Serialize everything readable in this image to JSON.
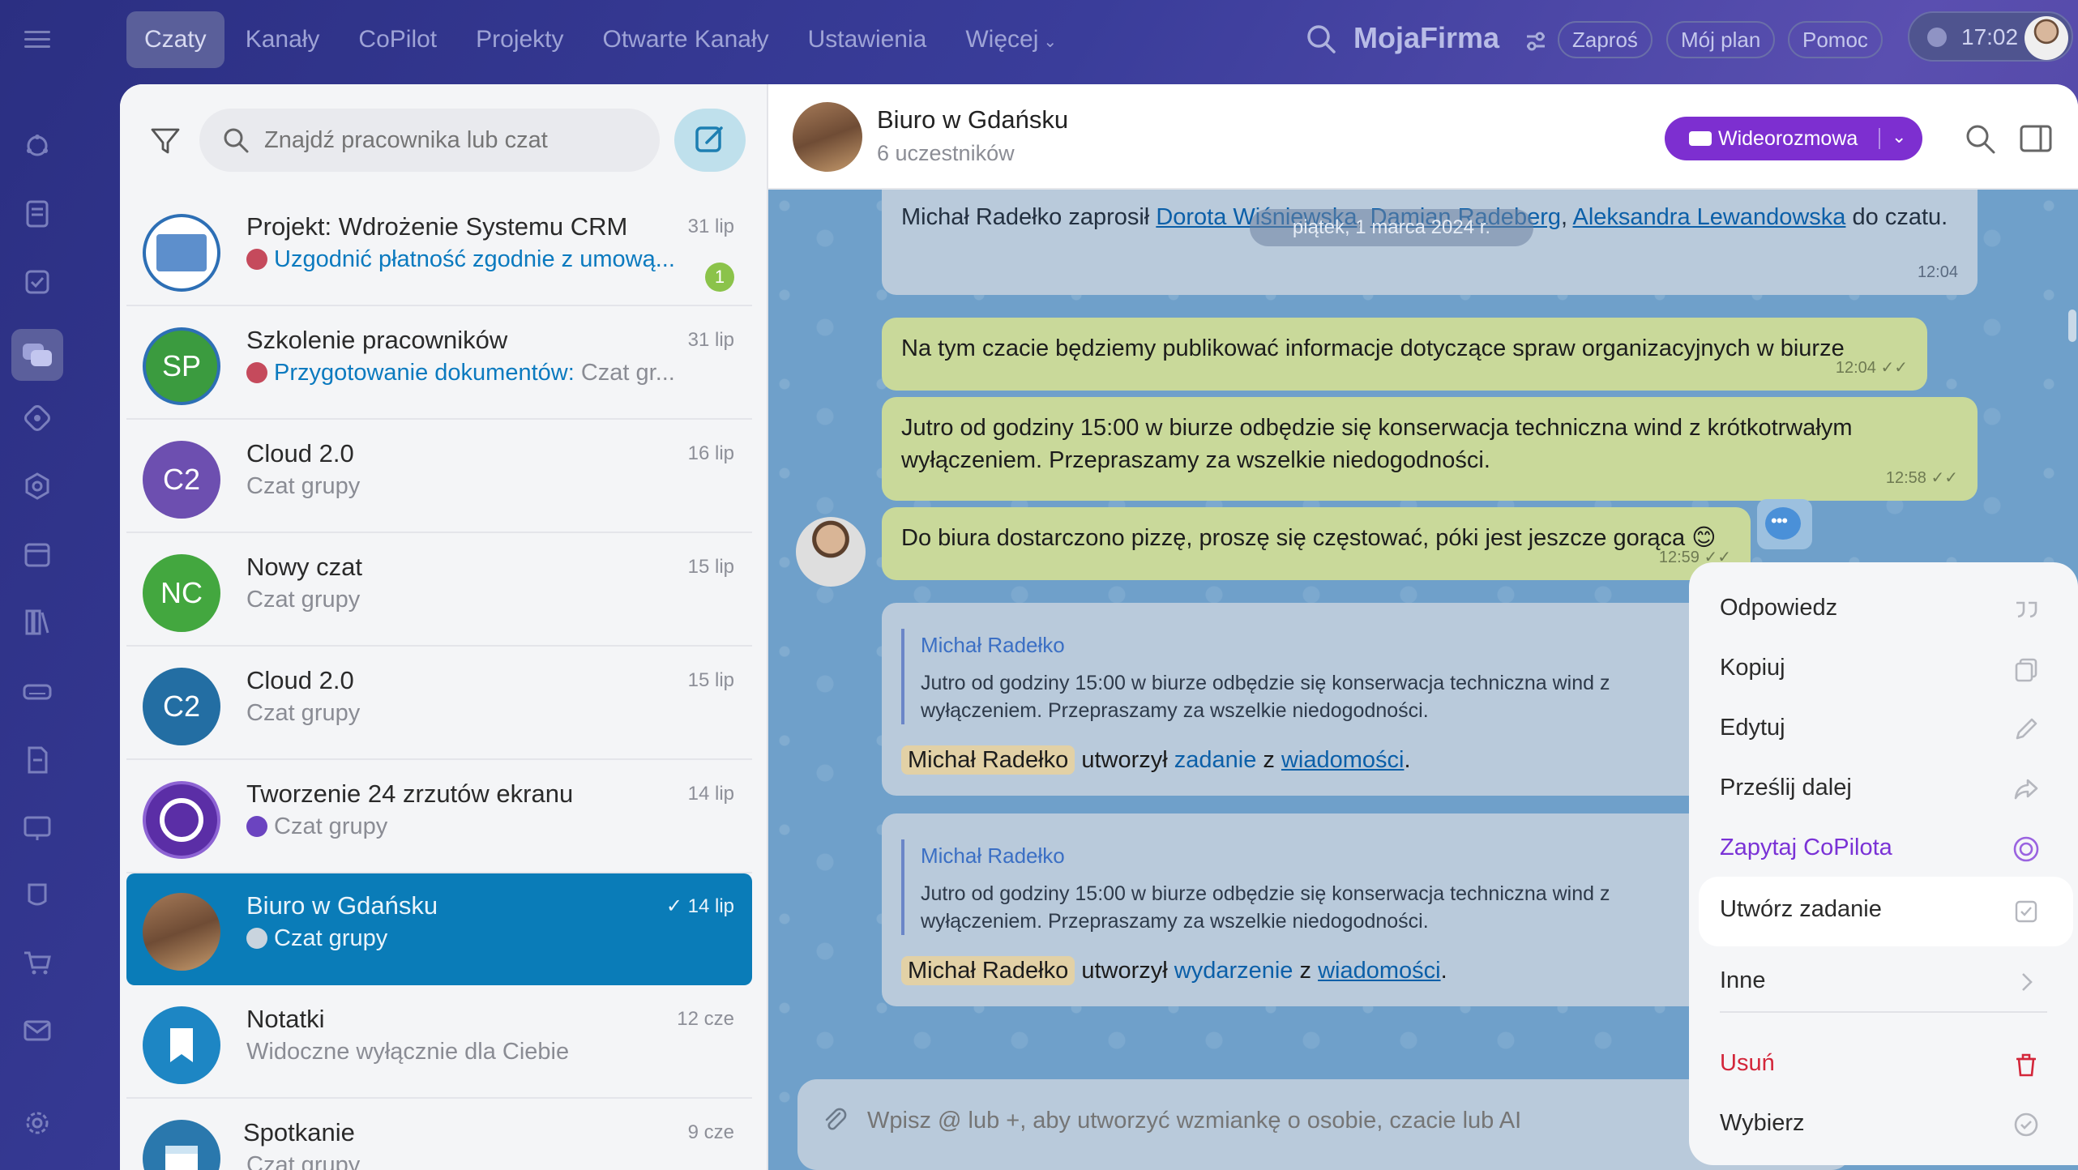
{
  "topnav": {
    "tabs": [
      "Czaty",
      "Kanały",
      "CoPilot",
      "Projekty",
      "Otwarte Kanały",
      "Ustawienia",
      "Więcej"
    ],
    "active_tab": "Czaty",
    "brand": "MojaFirma",
    "invite_label": "Zaproś",
    "plan_label": "Mój plan",
    "help_label": "Pomoc",
    "time": "17:02"
  },
  "list": {
    "search_placeholder": "Znajdź pracownika lub czat",
    "items": [
      {
        "name": "Projekt: Wdrożenie Systemu CRM",
        "date": "31 lip",
        "sub_hl": "Uzgodnić płatność zgodnie z umową...",
        "sub": "",
        "badge": "1",
        "avatar_text": "",
        "color": "#2d6fb5"
      },
      {
        "name": "Szkolenie pracowników",
        "date": "31 lip",
        "sub_hl": "Przygotowanie dokumentów:",
        "sub": " Czat gr...",
        "avatar_text": "SP",
        "color": "#3b9b3f"
      },
      {
        "name": "Cloud 2.0",
        "date": "16 lip",
        "sub_hl": "",
        "sub": "Czat grupy",
        "avatar_text": "C2",
        "color": "#6d4fb0"
      },
      {
        "name": "Nowy czat",
        "date": "15 lip",
        "sub_hl": "",
        "sub": "Czat grupy",
        "avatar_text": "NC",
        "color": "#43a73f"
      },
      {
        "name": "Cloud 2.0",
        "date": "15 lip",
        "sub_hl": "",
        "sub": "Czat grupy",
        "avatar_text": "C2",
        "color": "#236ea3"
      },
      {
        "name": "Tworzenie 24 zrzutów ekranu",
        "date": "14 lip",
        "sub_hl": "",
        "sub": "Czat grupy",
        "avatar_text": "",
        "color": "#5b2ea6"
      },
      {
        "name": "Biuro w Gdańsku",
        "date": "14 lip",
        "sub_hl": "",
        "sub": "Czat grupy",
        "avatar_text": "",
        "color": "#8c6040"
      },
      {
        "name": "Notatki",
        "date": "12 cze",
        "sub_hl": "",
        "sub": "Widoczne wyłącznie dla Ciebie",
        "avatar_text": "",
        "color": "#1d86c4"
      },
      {
        "name": "Spotkanie",
        "date": "9 cze",
        "sub_hl": "",
        "sub": "Czat grupy",
        "avatar_text": "",
        "color": "#2a78ad"
      }
    ]
  },
  "chat": {
    "title": "Biuro w Gdańsku",
    "subtitle": "6 uczestników",
    "video_label": "Wideorozmowa",
    "date_pill": "piątek, 1 marca 2024 r.",
    "system_msg": {
      "prefix": "Michał Radełko zaprosił",
      "names": [
        "Dorota Wiśniewska",
        "Damian Radeberg",
        "Aleksandra Lewandowska"
      ],
      "suffix": "do czatu.",
      "time": "12:04"
    },
    "messages": [
      {
        "text": "Na tym czacie będziemy publikować informacje dotyczące spraw organizacyjnych w biurze",
        "time": "12:04"
      },
      {
        "text": "Jutro od godziny 15:00 w biurze odbędzie się konserwacja techniczna wind z krótkotrwałym wyłączeniem. Przepraszamy za wszelkie niedogodności.",
        "time": "12:58"
      },
      {
        "text": "Do biura dostarczono pizzę, proszę się częstować, póki jest jeszcze gorąca",
        "time": "12:59"
      }
    ],
    "quotes": [
      {
        "author": "Michał Radełko",
        "text": "Jutro od godziny 15:00 w biurze odbędzie się konserwacja techniczna wind z",
        "text2": "wyłączeniem. Przepraszamy za wszelkie niedogodności.",
        "actor": "Michał Radełko",
        "verb": " utworzył ",
        "obj": "zadanie",
        "mid": " z ",
        "src": "wiadomości",
        "end": "."
      },
      {
        "author": "Michał Radełko",
        "text": "Jutro od godziny 15:00 w biurze odbędzie się konserwacja techniczna wind z",
        "text2": "wyłączeniem. Przepraszamy za wszelkie niedogodności.",
        "actor": "Michał Radełko",
        "verb": " utworzył ",
        "obj": "wydarzenie",
        "mid": " z ",
        "src": "wiadomości",
        "end": "."
      }
    ],
    "composer_placeholder": "Wpisz @ lub +, aby utworzyć wzmiankę o osobie, czacie lub AI"
  },
  "menu": {
    "items": [
      "Odpowiedz",
      "Kopiuj",
      "Edytuj",
      "Prześlij dalej",
      "Zapytaj CoPilota",
      "Utwórz zadanie",
      "Inne",
      "Usuń",
      "Wybierz"
    ]
  }
}
